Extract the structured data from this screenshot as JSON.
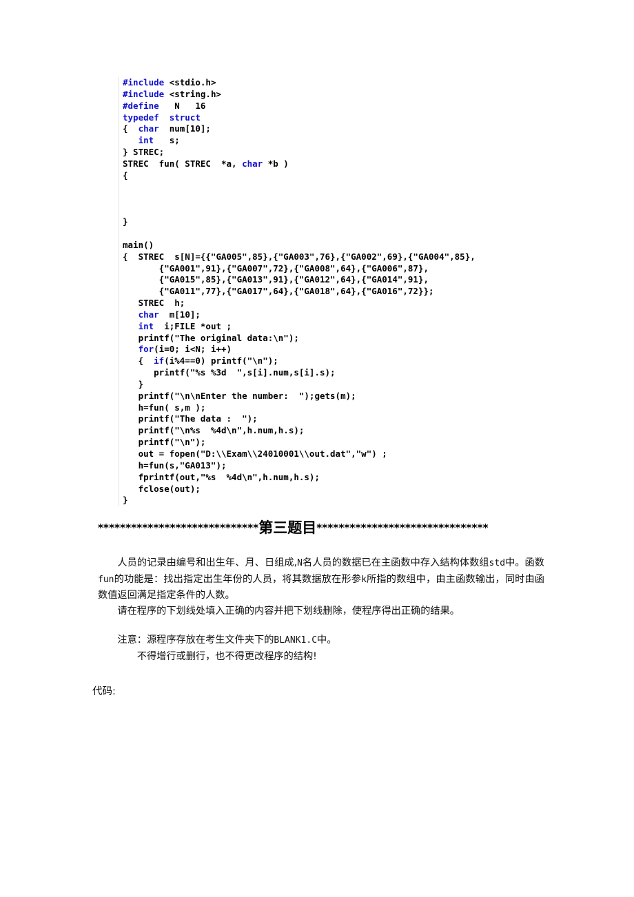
{
  "document": {
    "code_listing": {
      "lines": [
        [
          {
            "t": "#include",
            "k": true
          },
          {
            "t": " <stdio.h>",
            "k": false
          }
        ],
        [
          {
            "t": "#include",
            "k": true
          },
          {
            "t": " <string.h>",
            "k": false
          }
        ],
        [
          {
            "t": "#define",
            "k": true
          },
          {
            "t": "   N   16",
            "k": false
          }
        ],
        [
          {
            "t": "typedef  struct",
            "k": true
          }
        ],
        [
          {
            "t": "{  ",
            "k": false
          },
          {
            "t": "char",
            "k": true
          },
          {
            "t": "  num[10];",
            "k": false
          }
        ],
        [
          {
            "t": "   ",
            "k": false
          },
          {
            "t": "int",
            "k": true
          },
          {
            "t": "   s;",
            "k": false
          }
        ],
        [
          {
            "t": "} STREC;",
            "k": false
          }
        ],
        [
          {
            "t": "STREC  fun( STREC  *a, ",
            "k": false
          },
          {
            "t": "char",
            "k": true
          },
          {
            "t": " *b )",
            "k": false
          }
        ],
        [
          {
            "t": "{",
            "k": false
          }
        ],
        [],
        [],
        [],
        [
          {
            "t": "}",
            "k": false
          }
        ],
        [],
        [
          {
            "t": "main()",
            "k": false
          }
        ],
        [
          {
            "t": "{  STREC  s[N]={{\"GA005\",85},{\"GA003\",76},{\"GA002\",69},{\"GA004\",85},",
            "k": false
          }
        ],
        [
          {
            "t": "       {\"GA001\",91},{\"GA007\",72},{\"GA008\",64},{\"GA006\",87},",
            "k": false
          }
        ],
        [
          {
            "t": "       {\"GA015\",85},{\"GA013\",91},{\"GA012\",64},{\"GA014\",91},",
            "k": false
          }
        ],
        [
          {
            "t": "       {\"GA011\",77},{\"GA017\",64},{\"GA018\",64},{\"GA016\",72}};",
            "k": false
          }
        ],
        [
          {
            "t": "   STREC  h;",
            "k": false
          }
        ],
        [
          {
            "t": "   ",
            "k": false
          },
          {
            "t": "char",
            "k": true
          },
          {
            "t": "  m[10];",
            "k": false
          }
        ],
        [
          {
            "t": "   ",
            "k": false
          },
          {
            "t": "int",
            "k": true
          },
          {
            "t": "  i;FILE *out ;",
            "k": false
          }
        ],
        [
          {
            "t": "   printf(\"The original data:\\n\");",
            "k": false
          }
        ],
        [
          {
            "t": "   ",
            "k": false
          },
          {
            "t": "for",
            "k": true
          },
          {
            "t": "(i=0; i<N; i++)",
            "k": false
          }
        ],
        [
          {
            "t": "   {  ",
            "k": false
          },
          {
            "t": "if",
            "k": true
          },
          {
            "t": "(i%4==0) printf(\"\\n\");",
            "k": false
          }
        ],
        [
          {
            "t": "      printf(\"%s %3d  \",s[i].num,s[i].s);",
            "k": false
          }
        ],
        [
          {
            "t": "   }",
            "k": false
          }
        ],
        [
          {
            "t": "   printf(\"\\n\\nEnter the number:  \");gets(m);",
            "k": false
          }
        ],
        [
          {
            "t": "   h=fun( s,m );",
            "k": false
          }
        ],
        [
          {
            "t": "   printf(\"The data :  \");",
            "k": false
          }
        ],
        [
          {
            "t": "   printf(\"\\n%s  %4d\\n\",h.num,h.s);",
            "k": false
          }
        ],
        [
          {
            "t": "   printf(\"\\n\");",
            "k": false
          }
        ],
        [
          {
            "t": "   out = fopen(\"D:\\\\Exam\\\\24010001\\\\out.dat\",\"w\") ;",
            "k": false
          }
        ],
        [
          {
            "t": "   h=fun(s,\"GA013\");",
            "k": false
          }
        ],
        [
          {
            "t": "   fprintf(out,\"%s  %4d\\n\",h.num,h.s);",
            "k": false
          }
        ],
        [
          {
            "t": "   fclose(out);",
            "k": false
          }
        ],
        [
          {
            "t": "}",
            "k": false
          }
        ]
      ]
    },
    "separator": {
      "stars_left": "*****************************",
      "title": "第三题目",
      "stars_right": "*******************************"
    },
    "description": {
      "para1_a": "人员的记录由编号和出生年、月、日组成,",
      "para1_mono1": "N",
      "para1_b": "名人员的数据已在主函数中存入结构体数组",
      "para1_mono2": "std",
      "para1_c": "中。函数",
      "para1_mono3": "fun",
      "para1_d": "的功能是：找出指定出生年份的人员，将其数据放在形参",
      "para1_mono4": "k",
      "para1_e": "所指的数组中，由主函数输出，同时由函数值返回满足指定条件的人数。",
      "para2": "请在程序的下划线处填入正确的内容并把下划线删除，使程序得出正确的结果。"
    },
    "notes": {
      "note1_a": "注意：源程序存放在考生文件夹下的",
      "note1_mono": "BLANK1.C",
      "note1_b": "中。",
      "note2": "不得增行或删行，也不得更改程序的结构!"
    },
    "footer": {
      "code_label": "代码:"
    },
    "colors": {
      "keyword_blue": "#1111cc",
      "text_black": "#000000",
      "rule_gray": "#e2e2e2"
    }
  }
}
